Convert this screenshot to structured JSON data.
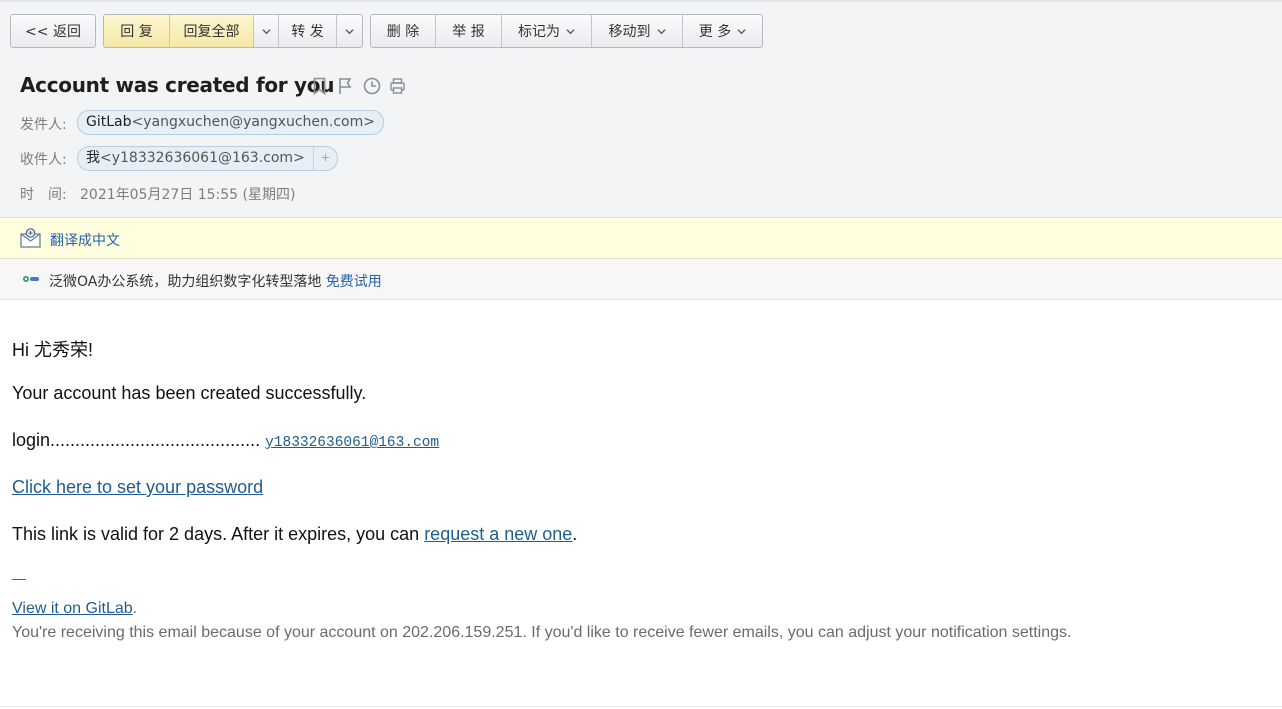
{
  "toolbar": {
    "back": "<< 返回",
    "reply": "回 复",
    "reply_all": "回复全部",
    "forward": "转 发",
    "delete": "删 除",
    "report": "举 报",
    "mark_as": "标记为",
    "move_to": "移动到",
    "more": "更 多"
  },
  "email": {
    "subject": "Account was created for you",
    "from_label": "发件人:",
    "from_name": "GitLab",
    "from_addr": "<yangxuchen@yangxuchen.com>",
    "to_label": "收件人:",
    "to_name": "我",
    "to_addr": "<y18332636061@163.com>",
    "add_symbol": "+",
    "time_label": "时　间:",
    "time_value": "2021年05月27日 15:55 (星期四)"
  },
  "translate_bar": {
    "link": "翻译成中文"
  },
  "ad_bar": {
    "text": "泛微OA办公系统，助力组织数字化转型落地",
    "link": "免费试用"
  },
  "body": {
    "greeting": "Hi 尤秀荣!",
    "line1": "Your account has been created successfully.",
    "login_label": "login..........................................",
    "login_value": "y18332636061@163.com",
    "set_password_link": "Click here to set your password",
    "validity_text": "This link is valid for 2 days. After it expires, you can",
    "request_link": "request a new one",
    "period": ".",
    "separator": "—",
    "gitlab_link": "View it on GitLab",
    "gitlab_period": ".",
    "footer": "You're receiving this email because of your account on 202.206.159.251. If you'd like to receive fewer emails, you can adjust your notification settings."
  },
  "icon_color": "#8a8f96",
  "link_color": "#1f5d8e"
}
